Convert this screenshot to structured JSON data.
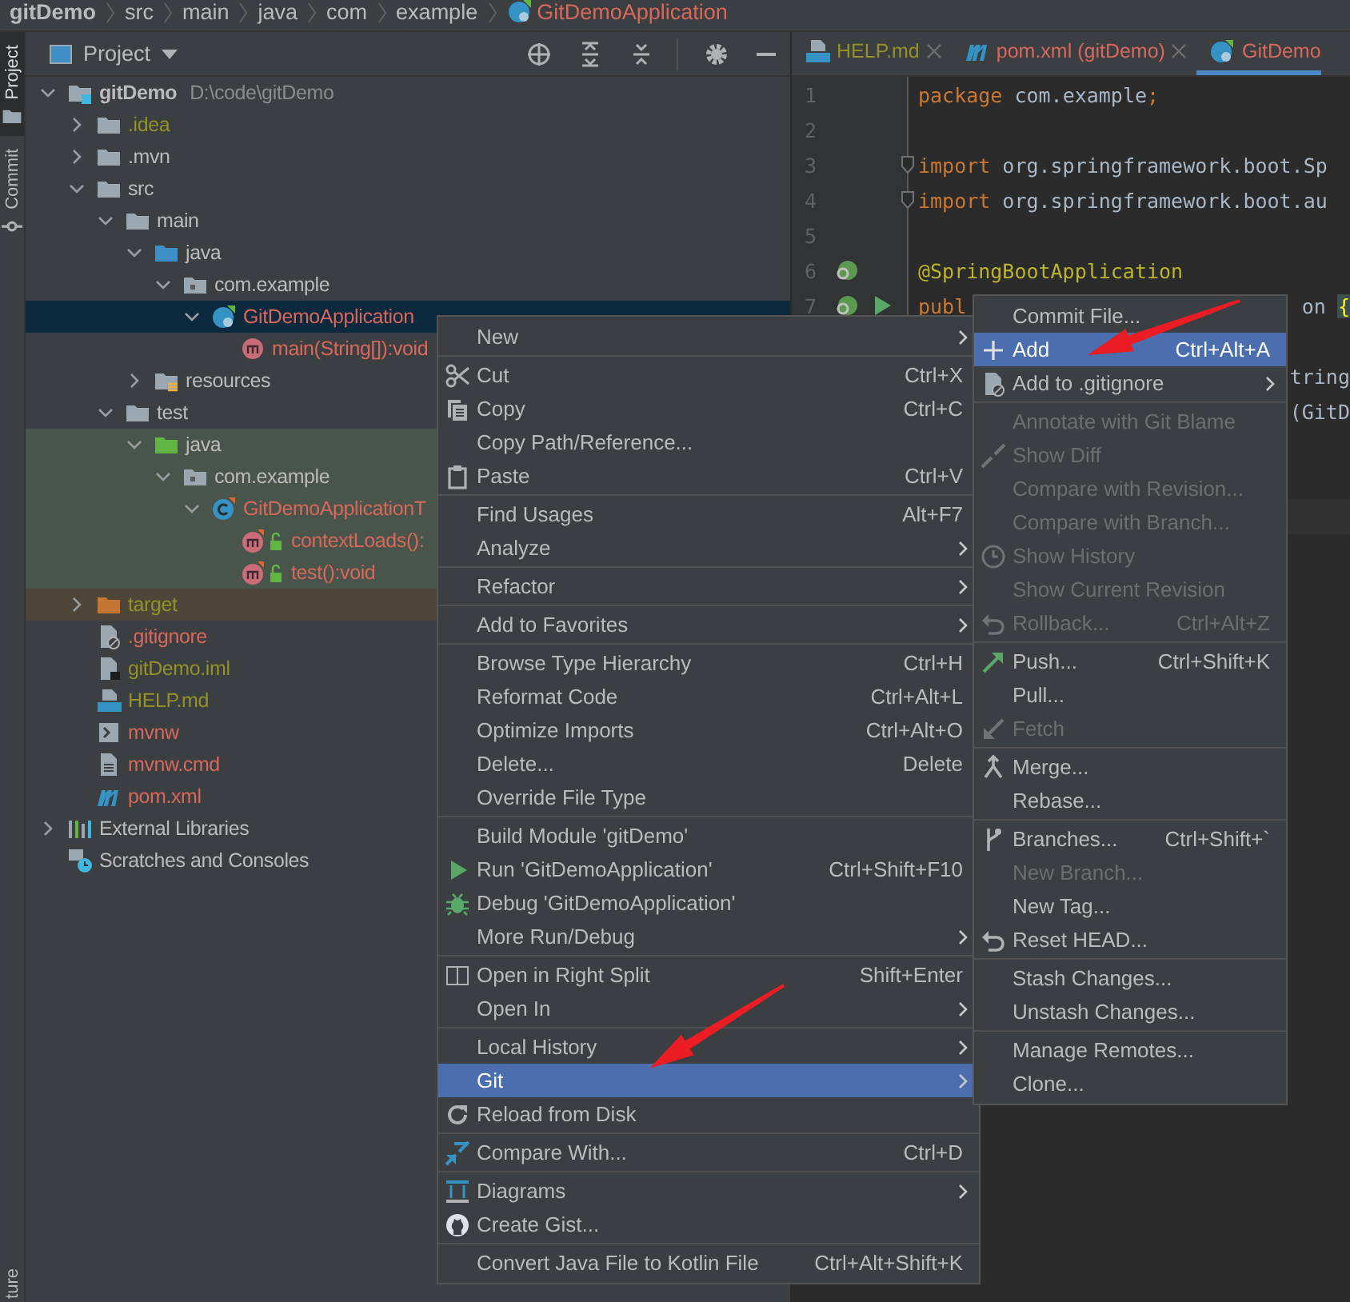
{
  "breadcrumb": [
    {
      "label": "gitDemo",
      "kind": "project",
      "color": "#bbbbbb"
    },
    {
      "label": "src",
      "kind": "folder",
      "color": "#bbbbbb"
    },
    {
      "label": "main",
      "kind": "folder",
      "color": "#bbbbbb"
    },
    {
      "label": "java",
      "kind": "folder",
      "color": "#bbbbbb"
    },
    {
      "label": "com",
      "kind": "folder",
      "color": "#bbbbbb"
    },
    {
      "label": "example",
      "kind": "folder",
      "color": "#bbbbbb"
    },
    {
      "label": "GitDemoApplication",
      "kind": "class",
      "color": "#d9685c"
    }
  ],
  "tool_stripe": {
    "top": [
      {
        "label": "Project",
        "kind": "project",
        "selected": true
      },
      {
        "label": "Commit",
        "kind": "commit",
        "selected": false
      }
    ],
    "bottom": [
      {
        "label": "ture",
        "selected": false
      }
    ]
  },
  "project_panel": {
    "title": "Project",
    "tree": [
      {
        "label": "gitDemo",
        "note": "D:\\code\\gitDemo",
        "kind": "module",
        "color": "#bbbbbb",
        "expanded": true,
        "selected": false,
        "children": [
          {
            "label": ".idea",
            "kind": "folder",
            "color": "#929228",
            "expanded": false,
            "selected": false
          },
          {
            "label": ".mvn",
            "kind": "folder",
            "color": "#bbbbbb",
            "expanded": false,
            "selected": false
          },
          {
            "label": "src",
            "kind": "folder",
            "color": "#bbbbbb",
            "expanded": true,
            "selected": false,
            "children": [
              {
                "label": "main",
                "kind": "folder",
                "color": "#bbbbbb",
                "expanded": true,
                "selected": false,
                "children": [
                  {
                    "label": "java",
                    "kind": "source-folder",
                    "color": "#bbbbbb",
                    "expanded": true,
                    "selected": false,
                    "children": [
                      {
                        "label": "com.example",
                        "kind": "package",
                        "color": "#bbbbbb",
                        "expanded": true,
                        "selected": false,
                        "children": [
                          {
                            "label": "GitDemoApplication",
                            "kind": "spring-class",
                            "color": "#d9685c",
                            "expanded": true,
                            "selected": true,
                            "children": [
                              {
                                "label": "main(String[]):void",
                                "kind": "method",
                                "color": "#d9685c",
                                "selected": false
                              }
                            ]
                          }
                        ]
                      }
                    ]
                  },
                  {
                    "label": "resources",
                    "kind": "resources",
                    "color": "#bbbbbb",
                    "expanded": false,
                    "selected": false
                  }
                ]
              },
              {
                "label": "test",
                "kind": "folder",
                "color": "#bbbbbb",
                "expanded": true,
                "selected": false,
                "children": [
                  {
                    "label": "java",
                    "kind": "test-folder",
                    "color": "#bbbbbb",
                    "test_scope": true,
                    "expanded": true,
                    "selected": false,
                    "children": [
                      {
                        "label": "com.example",
                        "kind": "package",
                        "color": "#bbbbbb",
                        "test_scope": true,
                        "expanded": true,
                        "selected": false,
                        "children": [
                          {
                            "label": "GitDemoApplicationT",
                            "kind": "test-class",
                            "color": "#d9685c",
                            "test_scope": true,
                            "expanded": true,
                            "selected": false,
                            "children": [
                              {
                                "label": "contextLoads():",
                                "kind": "test-method",
                                "color": "#d9685c",
                                "test_scope": true,
                                "selected": false
                              },
                              {
                                "label": "test():void",
                                "kind": "test-method",
                                "color": "#d9685c",
                                "test_scope": true,
                                "selected": false
                              }
                            ]
                          }
                        ]
                      }
                    ]
                  }
                ]
              }
            ]
          },
          {
            "label": "target",
            "kind": "excluded-folder",
            "color": "#929228",
            "excluded": true,
            "expanded": false,
            "selected": false
          },
          {
            "label": ".gitignore",
            "kind": "file-ignore",
            "color": "#d9685c",
            "selected": false
          },
          {
            "label": "gitDemo.iml",
            "kind": "file-iml",
            "color": "#929228",
            "selected": false
          },
          {
            "label": "HELP.md",
            "kind": "file-md",
            "color": "#929228",
            "selected": false
          },
          {
            "label": "mvnw",
            "kind": "file-script",
            "color": "#d9685c",
            "selected": false
          },
          {
            "label": "mvnw.cmd",
            "kind": "file-text",
            "color": "#d9685c",
            "selected": false
          },
          {
            "label": "pom.xml",
            "kind": "maven",
            "color": "#d9685c",
            "selected": false
          }
        ]
      },
      {
        "label": "External Libraries",
        "kind": "libraries",
        "color": "#bbbbbb",
        "expanded": false,
        "selected": false
      },
      {
        "label": "Scratches and Consoles",
        "kind": "scratches",
        "color": "#bbbbbb",
        "selected": false
      }
    ]
  },
  "editor": {
    "tabs": [
      {
        "label": "HELP.md",
        "kind": "file-md",
        "color": "#929228",
        "selected": false,
        "closable": true
      },
      {
        "label": "pom.xml (gitDemo)",
        "kind": "maven",
        "color": "#d9685c",
        "selected": false,
        "closable": true
      },
      {
        "label": "GitDemo",
        "kind": "spring-class",
        "color": "#d9685c",
        "selected": true,
        "closable": false
      }
    ],
    "lines": [
      {
        "number": "1",
        "current": false,
        "fold": false,
        "tokens": [
          {
            "kind": "keyword",
            "text": "package"
          },
          {
            "kind": "plain",
            "text": " com.example"
          },
          {
            "kind": "keyword",
            "text": ";"
          }
        ]
      },
      {
        "number": "2",
        "current": false,
        "fold": false
      },
      {
        "number": "3",
        "current": false,
        "fold": true,
        "tokens": [
          {
            "kind": "keyword",
            "text": "import"
          },
          {
            "kind": "plain",
            "text": " org.springframework.boot.Sp"
          }
        ]
      },
      {
        "number": "4",
        "current": false,
        "fold": true,
        "tokens": [
          {
            "kind": "keyword",
            "text": "import"
          },
          {
            "kind": "plain",
            "text": " org.springframework.boot.au"
          }
        ]
      },
      {
        "number": "5",
        "current": false,
        "fold": false
      },
      {
        "number": "6",
        "current": false,
        "fold": false,
        "kind": "bean",
        "tokens": [
          {
            "kind": "annotation",
            "text": "@SpringBootApplication"
          }
        ]
      },
      {
        "number": "7",
        "current": false,
        "fold": false,
        "kind": "run",
        "tokens": [
          {
            "kind": "keyword",
            "text": "publ"
          }
        ],
        "tail": [
          {
            "kind": "plain",
            "text": "on "
          },
          {
            "kind": "brace",
            "text": "{"
          }
        ]
      },
      {
        "kind": "blank"
      },
      {
        "current": false,
        "tail": [
          {
            "kind": "plain",
            "text": "tring"
          }
        ]
      },
      {
        "current": false,
        "tail": [
          {
            "kind": "plain",
            "text": "(GitD"
          }
        ]
      },
      {
        "kind": "blank"
      },
      {
        "kind": "blank"
      },
      {
        "current": true
      }
    ]
  },
  "context_menu": {
    "groups": [
      [
        {
          "label": "New",
          "submenu": true,
          "selected": false
        }
      ],
      [
        {
          "label": "Cut",
          "shortcut": "Ctrl+X",
          "kind": "cut",
          "submenu": false,
          "selected": false
        },
        {
          "label": "Copy",
          "shortcut": "Ctrl+C",
          "kind": "copy",
          "submenu": false,
          "selected": false
        },
        {
          "label": "Copy Path/Reference...",
          "submenu": false,
          "selected": false
        },
        {
          "label": "Paste",
          "shortcut": "Ctrl+V",
          "kind": "paste",
          "submenu": false,
          "selected": false
        }
      ],
      [
        {
          "label": "Find Usages",
          "shortcut": "Alt+F7",
          "submenu": false,
          "selected": false
        },
        {
          "label": "Analyze",
          "submenu": true,
          "selected": false
        }
      ],
      [
        {
          "label": "Refactor",
          "submenu": true,
          "selected": false
        }
      ],
      [
        {
          "label": "Add to Favorites",
          "submenu": true,
          "selected": false
        }
      ],
      [
        {
          "label": "Browse Type Hierarchy",
          "shortcut": "Ctrl+H",
          "submenu": false,
          "selected": false
        },
        {
          "label": "Reformat Code",
          "shortcut": "Ctrl+Alt+L",
          "submenu": false,
          "selected": false
        },
        {
          "label": "Optimize Imports",
          "shortcut": "Ctrl+Alt+O",
          "submenu": false,
          "selected": false
        },
        {
          "label": "Delete...",
          "shortcut": "Delete",
          "submenu": false,
          "selected": false
        },
        {
          "label": "Override File Type",
          "submenu": false,
          "selected": false
        }
      ],
      [
        {
          "label": "Build Module 'gitDemo'",
          "submenu": false,
          "selected": false
        },
        {
          "label": "Run 'GitDemoApplication'",
          "shortcut": "Ctrl+Shift+F10",
          "kind": "run",
          "submenu": false,
          "selected": false
        },
        {
          "label": "Debug 'GitDemoApplication'",
          "kind": "debug",
          "submenu": false,
          "selected": false
        },
        {
          "label": "More Run/Debug",
          "submenu": true,
          "selected": false
        }
      ],
      [
        {
          "label": "Open in Right Split",
          "shortcut": "Shift+Enter",
          "kind": "split",
          "submenu": false,
          "selected": false
        },
        {
          "label": "Open In",
          "submenu": true,
          "selected": false
        }
      ],
      [
        {
          "label": "Local History",
          "submenu": true,
          "selected": false
        },
        {
          "label": "Git",
          "submenu": true,
          "selected": true
        },
        {
          "label": "Reload from Disk",
          "kind": "reload",
          "submenu": false,
          "selected": false
        }
      ],
      [
        {
          "label": "Compare With...",
          "shortcut": "Ctrl+D",
          "kind": "compare",
          "submenu": false,
          "selected": false
        }
      ],
      [
        {
          "label": "Diagrams",
          "kind": "diagram",
          "submenu": true,
          "selected": false
        },
        {
          "label": "Create Gist...",
          "kind": "gist",
          "submenu": false,
          "selected": false
        }
      ],
      [
        {
          "label": "Convert Java File to Kotlin File",
          "shortcut": "Ctrl+Alt+Shift+K",
          "submenu": false,
          "selected": false
        }
      ]
    ]
  },
  "git_submenu": {
    "groups": [
      [
        {
          "label": "Commit File...",
          "submenu": false,
          "disabled": false,
          "selected": false
        },
        {
          "label": "Add",
          "shortcut": "Ctrl+Alt+A",
          "kind": "plus",
          "submenu": false,
          "disabled": false,
          "selected": true
        },
        {
          "label": "Add to .gitignore",
          "kind": "file-ignore",
          "submenu": true,
          "disabled": false,
          "selected": false
        }
      ],
      [
        {
          "label": "Annotate with Git Blame",
          "submenu": false,
          "disabled": true,
          "selected": false
        },
        {
          "label": "Show Diff",
          "kind": "diff",
          "submenu": false,
          "disabled": true,
          "selected": false
        },
        {
          "label": "Compare with Revision...",
          "submenu": false,
          "disabled": true,
          "selected": false
        },
        {
          "label": "Compare with Branch...",
          "submenu": false,
          "disabled": true,
          "selected": false
        },
        {
          "label": "Show History",
          "kind": "history",
          "submenu": false,
          "disabled": true,
          "selected": false
        },
        {
          "label": "Show Current Revision",
          "submenu": false,
          "disabled": true,
          "selected": false
        },
        {
          "label": "Rollback...",
          "shortcut": "Ctrl+Alt+Z",
          "kind": "undo",
          "submenu": false,
          "disabled": true,
          "selected": false
        }
      ],
      [
        {
          "label": "Push...",
          "shortcut": "Ctrl+Shift+K",
          "kind": "push",
          "submenu": false,
          "disabled": false,
          "selected": false
        },
        {
          "label": "Pull...",
          "submenu": false,
          "disabled": false,
          "selected": false
        },
        {
          "label": "Fetch",
          "kind": "fetch",
          "submenu": false,
          "disabled": true,
          "selected": false
        }
      ],
      [
        {
          "label": "Merge...",
          "kind": "merge",
          "submenu": false,
          "disabled": false,
          "selected": false
        },
        {
          "label": "Rebase...",
          "submenu": false,
          "disabled": false,
          "selected": false
        }
      ],
      [
        {
          "label": "Branches...",
          "shortcut": "Ctrl+Shift+`",
          "kind": "branch",
          "submenu": false,
          "disabled": false,
          "selected": false
        },
        {
          "label": "New Branch...",
          "submenu": false,
          "disabled": true,
          "selected": false
        },
        {
          "label": "New Tag...",
          "submenu": false,
          "disabled": false,
          "selected": false
        },
        {
          "label": "Reset HEAD...",
          "kind": "undo",
          "submenu": false,
          "disabled": false,
          "selected": false
        }
      ],
      [
        {
          "label": "Stash Changes...",
          "submenu": false,
          "disabled": false,
          "selected": false
        },
        {
          "label": "Unstash Changes...",
          "submenu": false,
          "disabled": false,
          "selected": false
        }
      ],
      [
        {
          "label": "Manage Remotes...",
          "submenu": false,
          "disabled": false,
          "selected": false
        },
        {
          "label": "Clone...",
          "submenu": false,
          "disabled": false,
          "selected": false
        }
      ]
    ]
  }
}
